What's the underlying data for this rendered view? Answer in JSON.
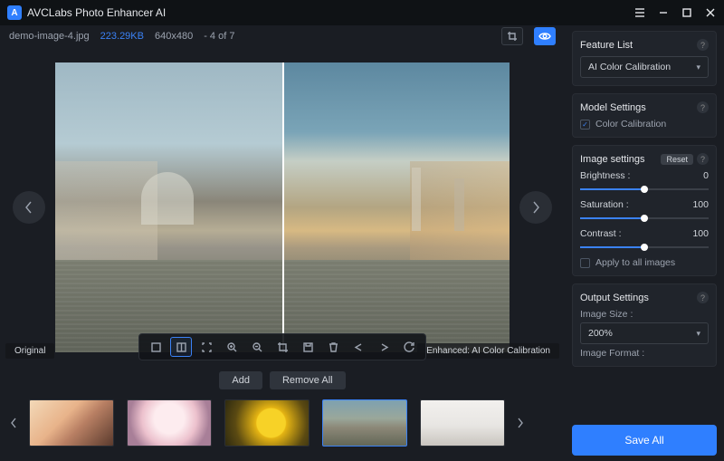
{
  "app": {
    "title": "AVCLabs Photo Enhancer AI"
  },
  "file": {
    "name": "demo-image-4.jpg",
    "size": "223.29KB",
    "dims": "640x480",
    "index": "- 4 of 7"
  },
  "preview": {
    "left_label": "Original",
    "right_label": "Enhanced: AI Color Calibration"
  },
  "buttons": {
    "add": "Add",
    "remove_all": "Remove All",
    "save_all": "Save All"
  },
  "sidebar": {
    "feature_list": {
      "title": "Feature List",
      "selected": "AI Color Calibration"
    },
    "model_settings": {
      "title": "Model Settings",
      "item": "Color Calibration"
    },
    "image_settings": {
      "title": "Image settings",
      "reset": "Reset",
      "brightness_label": "Brightness :",
      "brightness_value": "0",
      "saturation_label": "Saturation :",
      "saturation_value": "100",
      "contrast_label": "Contrast :",
      "contrast_value": "100",
      "apply_all": "Apply to all images"
    },
    "output": {
      "title": "Output Settings",
      "size_label": "Image Size :",
      "size_value": "200%",
      "format_label": "Image Format :"
    }
  }
}
